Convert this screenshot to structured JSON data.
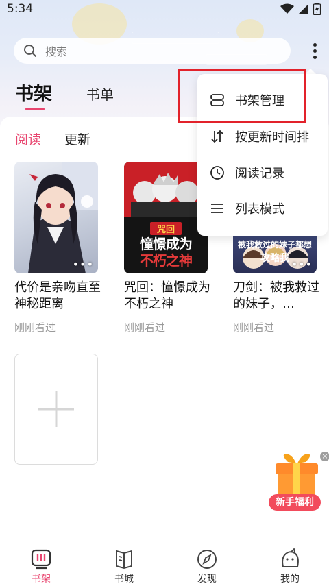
{
  "status_bar": {
    "time": "5:34"
  },
  "search": {
    "placeholder": "搜索"
  },
  "tabs": {
    "bookshelf": "书架",
    "booklist": "书单"
  },
  "subtabs": {
    "reading": "阅读",
    "updates": "更新"
  },
  "books": [
    {
      "title": "代价是亲吻直至神秘距离",
      "status": "刚刚看过"
    },
    {
      "title": "咒回：憧憬成为不朽之神",
      "status": "刚刚看过",
      "cover_text_top": "咒回",
      "cover_text_main": "憧憬成为",
      "cover_text_sub": "不朽之神"
    },
    {
      "title": "刀剑：被我救过的妹子，…",
      "status": "刚刚看过",
      "cover_text_main": "被我救过的妹子都想",
      "cover_text_sub": "攻略我"
    }
  ],
  "cover_dots": "•••",
  "menu": {
    "items": [
      {
        "label": "书架管理",
        "icon": "bookshelf-manage-icon"
      },
      {
        "label": "按更新时间排",
        "icon": "sort-icon"
      },
      {
        "label": "阅读记录",
        "icon": "clock-icon"
      },
      {
        "label": "列表模式",
        "icon": "list-icon"
      }
    ]
  },
  "gift": {
    "label": "新手福利",
    "close": "×"
  },
  "bottom_nav": [
    {
      "label": "书架",
      "icon": "bookshelf-icon",
      "active": true
    },
    {
      "label": "书城",
      "icon": "book-city-icon",
      "active": false
    },
    {
      "label": "发现",
      "icon": "compass-icon",
      "active": false
    },
    {
      "label": "我的",
      "icon": "profile-icon",
      "active": false
    }
  ],
  "colors": {
    "accent": "#e8456f",
    "highlight": "#e2222b",
    "gift": "#f24b5c"
  }
}
